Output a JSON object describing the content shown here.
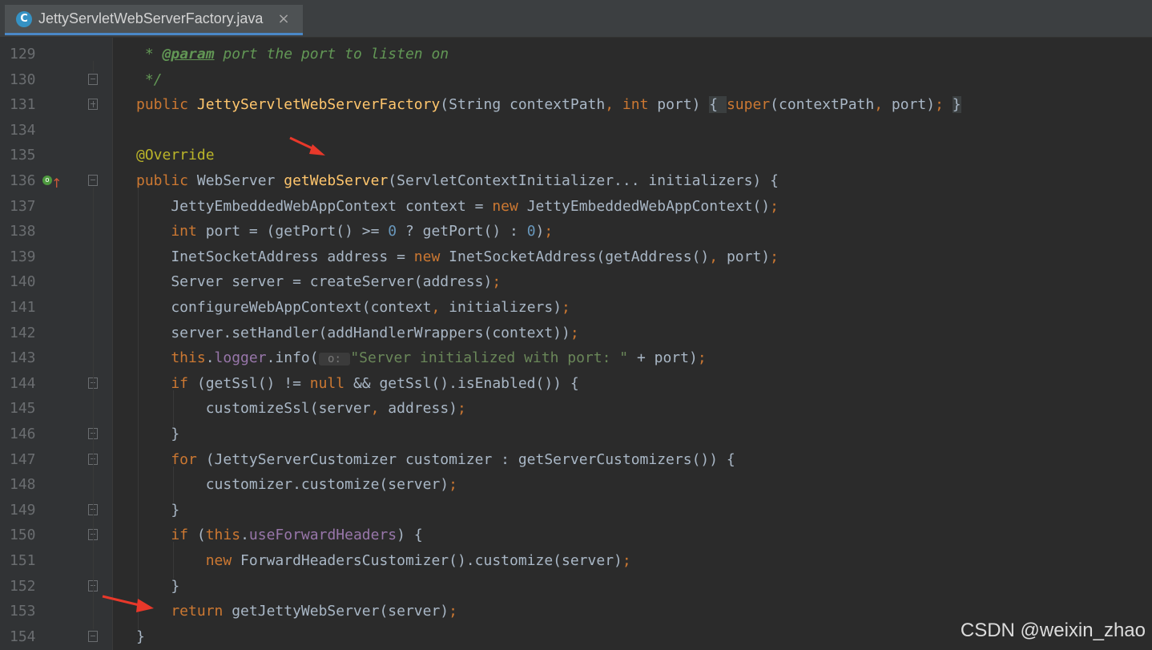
{
  "tab": {
    "icon_letter": "C",
    "filename": "JettyServletWebServerFactory.java",
    "close": "×"
  },
  "lines": [
    {
      "n": "129",
      "parts": [
        [
          "doc",
          " * "
        ],
        [
          "doctag",
          "@param"
        ],
        [
          "doc",
          " port the port to listen on"
        ]
      ]
    },
    {
      "n": "130",
      "parts": [
        [
          "doc",
          " */"
        ]
      ]
    },
    {
      "n": "131",
      "parts": [
        [
          "kw",
          "public "
        ],
        [
          "fn",
          "JettyServletWebServerFactory"
        ],
        [
          "plain",
          "(String contextPath"
        ],
        [
          "kw",
          ", "
        ],
        [
          "kw",
          "int "
        ],
        [
          "plain",
          "port) "
        ],
        [
          "brace",
          "{ "
        ],
        [
          "kw",
          "super"
        ],
        [
          "plain",
          "(contextPath"
        ],
        [
          "kw",
          ", "
        ],
        [
          "plain",
          "port)"
        ],
        [
          "kw",
          "; "
        ],
        [
          "brace",
          "}"
        ]
      ]
    },
    {
      "n": "134",
      "parts": []
    },
    {
      "n": "135",
      "parts": [
        [
          "ann",
          "@Override"
        ]
      ]
    },
    {
      "n": "136",
      "parts": [
        [
          "kw",
          "public "
        ],
        [
          "plain",
          "WebServer "
        ],
        [
          "fn",
          "getWebServer"
        ],
        [
          "plain",
          "(ServletContextInitializer... initializers) {"
        ]
      ]
    },
    {
      "n": "137",
      "parts": [
        [
          "plain",
          "    JettyEmbeddedWebAppContext context = "
        ],
        [
          "kw",
          "new "
        ],
        [
          "plain",
          "JettyEmbeddedWebAppContext()"
        ],
        [
          "kw",
          ";"
        ]
      ]
    },
    {
      "n": "138",
      "parts": [
        [
          "kw",
          "    int "
        ],
        [
          "plain",
          "port = (getPort() >= "
        ],
        [
          "num",
          "0"
        ],
        [
          "plain",
          " ? getPort() : "
        ],
        [
          "num",
          "0"
        ],
        [
          "plain",
          ")"
        ],
        [
          "kw",
          ";"
        ]
      ]
    },
    {
      "n": "139",
      "parts": [
        [
          "plain",
          "    InetSocketAddress address = "
        ],
        [
          "kw",
          "new "
        ],
        [
          "plain",
          "InetSocketAddress(getAddress()"
        ],
        [
          "kw",
          ", "
        ],
        [
          "plain",
          "port)"
        ],
        [
          "kw",
          ";"
        ]
      ]
    },
    {
      "n": "140",
      "parts": [
        [
          "plain",
          "    Server server = createServer(address)"
        ],
        [
          "kw",
          ";"
        ]
      ]
    },
    {
      "n": "141",
      "parts": [
        [
          "plain",
          "    configureWebAppContext(context"
        ],
        [
          "kw",
          ", "
        ],
        [
          "plain",
          "initializers)"
        ],
        [
          "kw",
          ";"
        ]
      ]
    },
    {
      "n": "142",
      "parts": [
        [
          "plain",
          "    server.setHandler(addHandlerWrappers(context))"
        ],
        [
          "kw",
          ";"
        ]
      ]
    },
    {
      "n": "143",
      "parts": [
        [
          "kw",
          "    this"
        ],
        [
          "plain",
          "."
        ],
        [
          "field",
          "logger"
        ],
        [
          "plain",
          ".info("
        ],
        [
          "hint",
          " o: "
        ],
        [
          "str",
          "\"Server initialized with port: \""
        ],
        [
          "plain",
          " + port)"
        ],
        [
          "kw",
          ";"
        ]
      ]
    },
    {
      "n": "144",
      "parts": [
        [
          "kw",
          "    if "
        ],
        [
          "plain",
          "(getSsl() != "
        ],
        [
          "kw",
          "null "
        ],
        [
          "plain",
          "&& getSsl().isEnabled()) {"
        ]
      ]
    },
    {
      "n": "145",
      "parts": [
        [
          "plain",
          "        customizeSsl(server"
        ],
        [
          "kw",
          ", "
        ],
        [
          "plain",
          "address)"
        ],
        [
          "kw",
          ";"
        ]
      ]
    },
    {
      "n": "146",
      "parts": [
        [
          "plain",
          "    }"
        ]
      ]
    },
    {
      "n": "147",
      "parts": [
        [
          "kw",
          "    for "
        ],
        [
          "plain",
          "(JettyServerCustomizer customizer : getServerCustomizers()) {"
        ]
      ]
    },
    {
      "n": "148",
      "parts": [
        [
          "plain",
          "        customizer.customize(server)"
        ],
        [
          "kw",
          ";"
        ]
      ]
    },
    {
      "n": "149",
      "parts": [
        [
          "plain",
          "    }"
        ]
      ]
    },
    {
      "n": "150",
      "parts": [
        [
          "kw",
          "    if "
        ],
        [
          "plain",
          "("
        ],
        [
          "kw",
          "this"
        ],
        [
          "plain",
          "."
        ],
        [
          "field",
          "useForwardHeaders"
        ],
        [
          "plain",
          ") {"
        ]
      ]
    },
    {
      "n": "151",
      "parts": [
        [
          "kw",
          "        new "
        ],
        [
          "plain",
          "ForwardHeadersCustomizer().customize(server)"
        ],
        [
          "kw",
          ";"
        ]
      ]
    },
    {
      "n": "152",
      "parts": [
        [
          "plain",
          "    }"
        ]
      ]
    },
    {
      "n": "153",
      "parts": [
        [
          "kw",
          "    return "
        ],
        [
          "plain",
          "getJettyWebServer(server)"
        ],
        [
          "kw",
          ";"
        ]
      ]
    },
    {
      "n": "154",
      "parts": [
        [
          "plain",
          "}"
        ]
      ]
    }
  ],
  "watermark": "CSDN @weixin_zhao",
  "colors": {
    "keyword": "#cc7832",
    "method": "#ffc66d",
    "number": "#6897bb",
    "string": "#6a8759",
    "annotation": "#bbb529",
    "field": "#9876aa",
    "doc": "#629755",
    "arrow": "#e8382a"
  }
}
